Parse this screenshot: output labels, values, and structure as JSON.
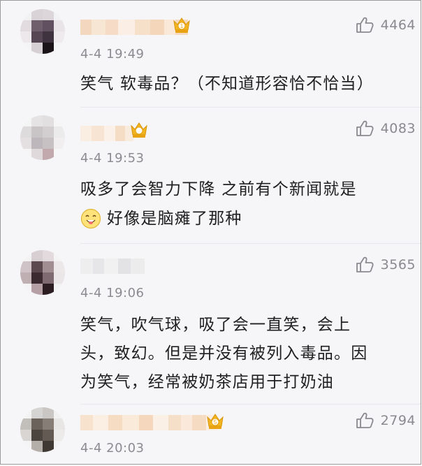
{
  "comments": [
    {
      "likes": "4464",
      "time": "4-4 19:49",
      "text": "笑气 软毒品？（不知道形容恰不恰当）",
      "badge": "1"
    },
    {
      "likes": "4083",
      "time": "4-4 19:53",
      "line1": "吸多了会智力下降  之前有个新闻就是",
      "line2": "好像是脑瘫了那种",
      "emoji": "silly-face-emoji"
    },
    {
      "likes": "3565",
      "time": "4-4 19:06",
      "line1": "笑气，吹气球，吸了会一直笑，会上",
      "line2": "头，致幻。但是并没有被列入毒品。因",
      "line3": "为笑气，经常被奶茶店用于打奶油"
    },
    {
      "likes": "2794",
      "time": "4-4 20:03",
      "badge": "5"
    }
  ],
  "colors": {
    "background": "#f6f6f8",
    "text": "#1f1f1f",
    "meta": "#8c8c90",
    "crown": "#f2b51f"
  }
}
